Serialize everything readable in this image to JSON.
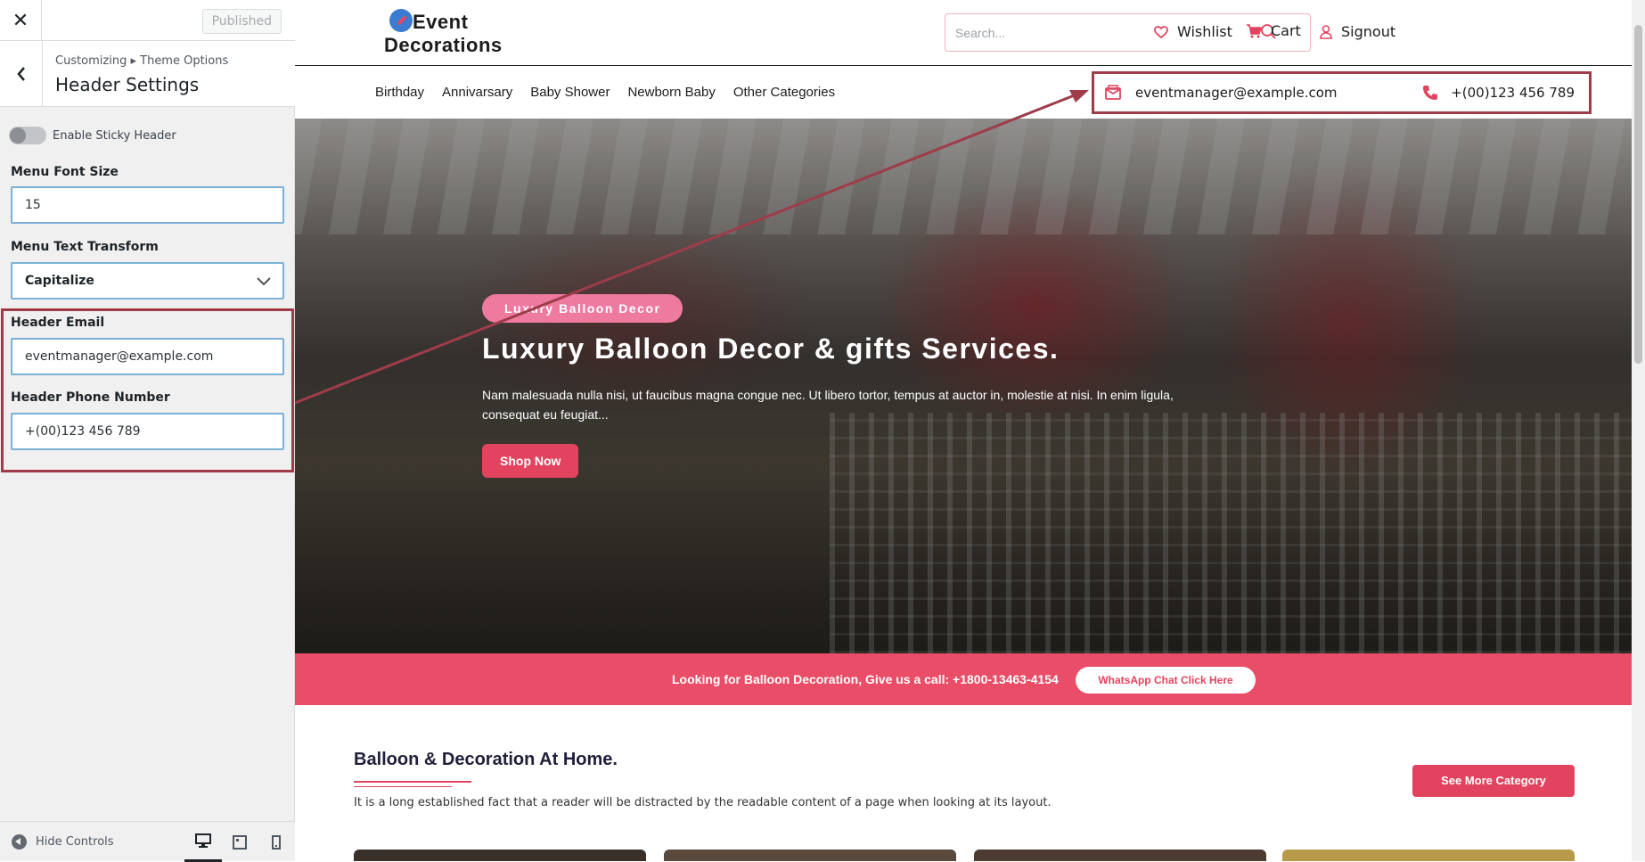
{
  "sidebar": {
    "close_label": "✕",
    "published_label": "Published",
    "breadcrumb": "Customizing ▸ Theme Options",
    "section_title": "Header Settings",
    "sticky_header_label": "Enable Sticky Header",
    "sticky_header_enabled": false,
    "menu_font_size_label": "Menu Font Size",
    "menu_font_size_value": "15",
    "menu_text_transform_label": "Menu Text Transform",
    "menu_text_transform_value": "Capitalize",
    "header_email_label": "Header Email",
    "header_email_value": "eventmanager@example.com",
    "header_phone_label": "Header Phone Number",
    "header_phone_value": "+(00)123 456 789",
    "hide_controls_label": "Hide Controls",
    "devices": [
      "desktop",
      "tablet",
      "mobile"
    ],
    "active_device": "desktop"
  },
  "site": {
    "logo_line1": "Event",
    "logo_line2": "Decorations",
    "search_placeholder": "Search...",
    "wishlist_label": "Wishlist",
    "cart_label": "Cart",
    "signout_label": "Signout",
    "nav": [
      "Birthday",
      "Annivarsary",
      "Baby Shower",
      "Newborn Baby",
      "Other Categories"
    ],
    "contact_email": "eventmanager@example.com",
    "contact_phone": "+(00)123 456 789",
    "hero": {
      "pill": "Luxury Balloon Decor",
      "title": "Luxury Balloon Decor & gifts Services.",
      "text": "Nam malesuada nulla nisi, ut faucibus magna congue nec. Ut libero tortor, tempus at auctor in, molestie at nisi. In enim ligula, consequat eu feugiat...",
      "button": "Shop Now"
    },
    "callbar": {
      "text": "Looking for Balloon Decoration, Give us a call: +1800-13463-4154",
      "button": "WhatsApp Chat Click Here"
    },
    "section": {
      "title": "Balloon & Decoration At Home.",
      "text": "It is a long established fact that a reader will be distracted by the readable content of a page when looking at its layout.",
      "button": "See More Category"
    }
  },
  "colors": {
    "accent": "#e2445f",
    "highlight_border": "#9e3c4a",
    "pill": "#ef7aa0"
  }
}
